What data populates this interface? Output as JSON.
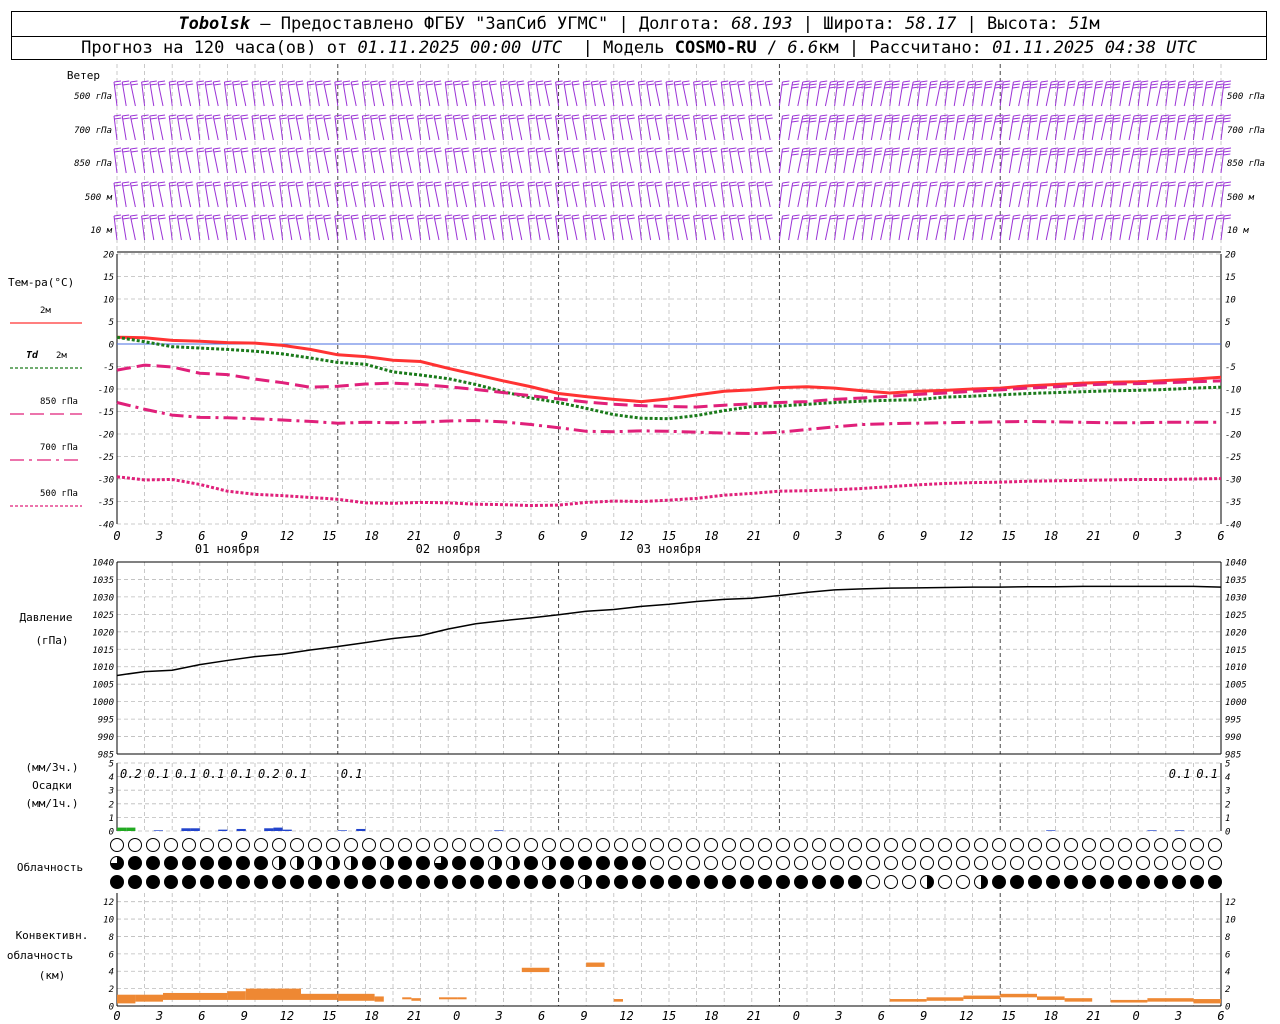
{
  "header": {
    "station": "Tobolsk",
    "sep": " — ",
    "provider": "Предоставлено ФГБУ \"ЗапСиб УГМС\"",
    "lon_label": "Долгота:",
    "lon": "68.193",
    "lat_label": "Широта:",
    "lat": "58.17",
    "alt_label": "Высота:",
    "alt": "51",
    "alt_unit": "м",
    "forecast_prefix": "Прогноз на 120 часа(ов) от",
    "forecast_from": "01.11.2025 00:00 UTC",
    "model_label": "Модель",
    "model": "COSMO-RU",
    "model_res": "6.6",
    "model_res_unit": "км",
    "calc_label": "Рассчитано:",
    "calc_time": "01.11.2025 04:38 UTC"
  },
  "chart_data": [
    {
      "type": "wind-barbs",
      "panel_label": "Ветер",
      "levels": [
        "500 гПа",
        "700 гПа",
        "850 гПа",
        "500 м",
        "10 м"
      ],
      "x_hours": [
        0,
        120
      ],
      "colors": {
        "barb": "#9b34d6"
      },
      "time_step_hours": 1
    },
    {
      "type": "line",
      "panel_label": "Тем-ра(°C)",
      "ylim": [
        -40,
        20
      ],
      "yticks": [
        20,
        15,
        10,
        5,
        0,
        -5,
        -10,
        -15,
        -20,
        -25,
        -30,
        -35,
        -40
      ],
      "grid": true,
      "zero_line_color": "#4a6fe0",
      "legend": [
        {
          "label": "2м",
          "prefix": "",
          "color": "#ff3333",
          "style": "solid"
        },
        {
          "label": "2м",
          "prefix": "Td",
          "color": "#1a7a1a",
          "style": "dotted"
        },
        {
          "label": "850 гПа",
          "prefix": "",
          "color": "#e0207a",
          "style": "dashed"
        },
        {
          "label": "700 гПа",
          "prefix": "",
          "color": "#e0207a",
          "style": "dashdot"
        },
        {
          "label": "500 гПа",
          "prefix": "",
          "color": "#e0207a",
          "style": "dotted"
        }
      ],
      "x_hours": [
        0,
        3,
        6,
        9,
        12,
        15,
        18,
        21,
        24,
        27,
        30,
        33,
        36,
        39,
        42,
        45,
        48,
        51,
        54,
        57,
        60,
        63,
        66,
        69,
        72,
        75,
        78,
        81,
        84,
        87,
        90,
        93,
        96,
        99,
        102,
        105,
        108,
        111,
        114,
        117,
        120
      ],
      "series": [
        {
          "name": "2м",
          "values": [
            1.5,
            1.4,
            0.8,
            0.6,
            0.3,
            0.2,
            -0.3,
            -1.2,
            -2.4,
            -2.8,
            -3.6,
            -3.9,
            -5.4,
            -6.8,
            -8.2,
            -9.5,
            -11.0,
            -11.7,
            -12.3,
            -12.8,
            -12.2,
            -11.3,
            -10.5,
            -10.2,
            -9.7,
            -9.5,
            -9.8,
            -10.4,
            -10.9,
            -10.5,
            -10.3,
            -10.0,
            -9.8,
            -9.3,
            -9.0,
            -8.7,
            -8.5,
            -8.4,
            -8.1,
            -7.8,
            -7.4
          ]
        },
        {
          "name": "Td 2м",
          "values": [
            1.5,
            0.5,
            -0.6,
            -0.9,
            -1.2,
            -1.6,
            -2.2,
            -3.1,
            -4.1,
            -4.5,
            -6.2,
            -6.9,
            -7.7,
            -9.0,
            -10.6,
            -12.0,
            -13.0,
            -14.3,
            -15.7,
            -16.5,
            -16.6,
            -15.9,
            -14.8,
            -13.9,
            -13.8,
            -13.4,
            -13.0,
            -12.7,
            -12.5,
            -12.4,
            -11.8,
            -11.6,
            -11.3,
            -11.0,
            -10.8,
            -10.6,
            -10.4,
            -10.3,
            -10.1,
            -9.8,
            -9.6
          ]
        },
        {
          "name": "850 гПа",
          "values": [
            -5.8,
            -4.7,
            -5.1,
            -6.5,
            -6.8,
            -7.8,
            -8.6,
            -9.6,
            -9.4,
            -8.9,
            -8.7,
            -9.0,
            -9.5,
            -10.1,
            -10.8,
            -11.5,
            -12.2,
            -12.9,
            -13.4,
            -13.7,
            -13.9,
            -14.0,
            -13.6,
            -13.3,
            -13.0,
            -12.8,
            -12.3,
            -12.0,
            -11.6,
            -11.2,
            -10.9,
            -10.5,
            -10.2,
            -9.8,
            -9.5,
            -9.1,
            -8.9,
            -8.8,
            -8.6,
            -8.4,
            -8.2
          ]
        },
        {
          "name": "700 гПа",
          "values": [
            -13.0,
            -14.5,
            -15.8,
            -16.3,
            -16.4,
            -16.6,
            -16.9,
            -17.2,
            -17.6,
            -17.4,
            -17.5,
            -17.4,
            -17.1,
            -17.0,
            -17.3,
            -17.9,
            -18.6,
            -19.4,
            -19.5,
            -19.3,
            -19.4,
            -19.6,
            -19.8,
            -19.9,
            -19.6,
            -19.0,
            -18.4,
            -17.9,
            -17.7,
            -17.6,
            -17.5,
            -17.4,
            -17.3,
            -17.2,
            -17.3,
            -17.4,
            -17.5,
            -17.5,
            -17.4,
            -17.4,
            -17.4
          ]
        },
        {
          "name": "500 гПа",
          "values": [
            -29.5,
            -30.2,
            -30.1,
            -31.2,
            -32.7,
            -33.4,
            -33.7,
            -34.1,
            -34.5,
            -35.3,
            -35.4,
            -35.2,
            -35.3,
            -35.6,
            -35.7,
            -35.9,
            -35.8,
            -35.2,
            -34.9,
            -35.0,
            -34.7,
            -34.3,
            -33.6,
            -33.2,
            -32.7,
            -32.6,
            -32.4,
            -32.1,
            -31.7,
            -31.3,
            -31.0,
            -30.8,
            -30.7,
            -30.5,
            -30.4,
            -30.3,
            -30.2,
            -30.1,
            -30.1,
            -30.0,
            -29.9
          ]
        }
      ]
    },
    {
      "type": "line",
      "panel_label": "Давление",
      "panel_unit": "(гПа)",
      "ylim": [
        985,
        1040
      ],
      "yticks": [
        1040,
        1035,
        1030,
        1025,
        1020,
        1015,
        1010,
        1005,
        1000,
        995,
        990,
        985
      ],
      "grid": true,
      "x_hours": [
        0,
        3,
        6,
        9,
        12,
        15,
        18,
        21,
        24,
        27,
        30,
        33,
        36,
        39,
        42,
        45,
        48,
        51,
        54,
        57,
        60,
        63,
        66,
        69,
        72,
        75,
        78,
        81,
        84,
        87,
        90,
        93,
        96,
        99,
        102,
        105,
        108,
        111,
        114,
        117,
        120
      ],
      "series": [
        {
          "name": "",
          "values": [
            1007.5,
            1008.6,
            1009.0,
            1010.6,
            1011.8,
            1012.9,
            1013.6,
            1014.8,
            1015.8,
            1016.9,
            1018.1,
            1018.9,
            1020.8,
            1022.3,
            1023.2,
            1024.0,
            1024.9,
            1025.9,
            1026.4,
            1027.3,
            1027.9,
            1028.7,
            1029.3,
            1029.6,
            1030.4,
            1031.3,
            1032.0,
            1032.3,
            1032.5,
            1032.6,
            1032.7,
            1032.8,
            1032.8,
            1032.9,
            1032.9,
            1033.0,
            1033.0,
            1033.0,
            1033.0,
            1033.0,
            1032.8
          ]
        }
      ],
      "colors": {
        "line": "#000000"
      }
    },
    {
      "type": "bar",
      "panel_label": "Осадки",
      "unit_top": "(мм/3ч.)",
      "unit_bottom": "(мм/1ч.)",
      "ylim": [
        0,
        5
      ],
      "yticks": [
        5,
        4,
        3,
        2,
        1,
        0
      ],
      "grid": true,
      "labels_3h": [
        {
          "hour": 1.5,
          "text": "0.2"
        },
        {
          "hour": 4.5,
          "text": "0.1"
        },
        {
          "hour": 7.5,
          "text": "0.1"
        },
        {
          "hour": 10.5,
          "text": "0.1"
        },
        {
          "hour": 13.5,
          "text": "0.1"
        },
        {
          "hour": 16.5,
          "text": "0.2"
        },
        {
          "hour": 19.5,
          "text": "0.1"
        },
        {
          "hour": 25.5,
          "text": "0.1"
        },
        {
          "hour": 115.5,
          "text": "0.1"
        },
        {
          "hour": 118.5,
          "text": "0.1"
        }
      ],
      "bars_1h": [
        {
          "hour": 1,
          "value": 0.25,
          "color": "#22aa22"
        },
        {
          "hour": 2,
          "value": 0.25,
          "color": "#22aa22"
        },
        {
          "hour": 5,
          "value": 0.05,
          "color": "#2244cc"
        },
        {
          "hour": 8,
          "value": 0.2,
          "color": "#2244cc"
        },
        {
          "hour": 9,
          "value": 0.2,
          "color": "#2244cc"
        },
        {
          "hour": 12,
          "value": 0.1,
          "color": "#2244cc"
        },
        {
          "hour": 14,
          "value": 0.15,
          "color": "#2244cc"
        },
        {
          "hour": 17,
          "value": 0.2,
          "color": "#2244cc"
        },
        {
          "hour": 18,
          "value": 0.25,
          "color": "#2244cc"
        },
        {
          "hour": 19,
          "value": 0.1,
          "color": "#2244cc"
        },
        {
          "hour": 25,
          "value": 0.05,
          "color": "#2244cc"
        },
        {
          "hour": 27,
          "value": 0.15,
          "color": "#2244cc"
        },
        {
          "hour": 42,
          "value": 0.05,
          "color": "#2244cc"
        },
        {
          "hour": 102,
          "value": 0.05,
          "color": "#2244cc"
        },
        {
          "hour": 113,
          "value": 0.05,
          "color": "#2244cc"
        },
        {
          "hour": 116,
          "value": 0.05,
          "color": "#2244cc"
        }
      ]
    },
    {
      "type": "cloud-symbols",
      "panel_label": "Облачность",
      "rows": [
        "верхний ярус",
        "средний ярус",
        "нижний ярус"
      ],
      "note": "octa cover 0–8 per 1h step",
      "upper": [
        0,
        0,
        0,
        0,
        0,
        0,
        0,
        0,
        0,
        0,
        0,
        0,
        0,
        0,
        0,
        0,
        0,
        0,
        0,
        0,
        0,
        0,
        0,
        0,
        0,
        0,
        0,
        0,
        0,
        0,
        0,
        0,
        0,
        0,
        0,
        0,
        0,
        0,
        0,
        0,
        0,
        0,
        0,
        0,
        0,
        0,
        0,
        0,
        0,
        0,
        0,
        0,
        0,
        0,
        0,
        0,
        0,
        0,
        0,
        0,
        0,
        0,
        0,
        0,
        0,
        0,
        0,
        0,
        0,
        0,
        0,
        0,
        0,
        0,
        0,
        0,
        0,
        0,
        0,
        0,
        0,
        0,
        0,
        0,
        0,
        0,
        0,
        0,
        0,
        0,
        0,
        0,
        0,
        0,
        0,
        0,
        0,
        0,
        0,
        0,
        0,
        0,
        0,
        0,
        0,
        0,
        0,
        0,
        0,
        0,
        0,
        0,
        0,
        0,
        0,
        0,
        0,
        0,
        0,
        0,
        0
      ],
      "middle": [
        6,
        8,
        8,
        8,
        8,
        8,
        8,
        8,
        8,
        8,
        8,
        8,
        8,
        8,
        8,
        4,
        8,
        8,
        4,
        4,
        4,
        4,
        4,
        4,
        4,
        4,
        4,
        6,
        8,
        8,
        4,
        8,
        8,
        8,
        8,
        6,
        8,
        8,
        8,
        8,
        4,
        4,
        4,
        4,
        6,
        8,
        8,
        4,
        8,
        8,
        4,
        8,
        8,
        8,
        4,
        8,
        8,
        8,
        6,
        0,
        0,
        0,
        0,
        0,
        0,
        0,
        0,
        0,
        0,
        0,
        0,
        0,
        0,
        0,
        0,
        0,
        0,
        0,
        0,
        0,
        0,
        0,
        0,
        0,
        0,
        0,
        0,
        0,
        0,
        0,
        0,
        0,
        0,
        0,
        0,
        0,
        0,
        0,
        0,
        0,
        0,
        0,
        0,
        0,
        0,
        0,
        0,
        0,
        0,
        0,
        0,
        0,
        0,
        0,
        0,
        0,
        0,
        0,
        0,
        0,
        0
      ],
      "lower": [
        8,
        8,
        8,
        8,
        8,
        8,
        8,
        8,
        8,
        8,
        8,
        8,
        8,
        8,
        8,
        8,
        8,
        8,
        8,
        8,
        8,
        8,
        8,
        8,
        8,
        8,
        8,
        8,
        8,
        8,
        8,
        8,
        8,
        8,
        8,
        8,
        8,
        8,
        8,
        8,
        8,
        8,
        8,
        8,
        8,
        8,
        8,
        8,
        8,
        8,
        4,
        4,
        8,
        8,
        8,
        8,
        8,
        8,
        8,
        8,
        8,
        8,
        8,
        8,
        8,
        8,
        8,
        8,
        8,
        8,
        8,
        8,
        8,
        8,
        8,
        8,
        8,
        8,
        8,
        8,
        0,
        8,
        8,
        0,
        0,
        0,
        0,
        0,
        0,
        4,
        0,
        0,
        0,
        0,
        4,
        0,
        8,
        8,
        8,
        8,
        8,
        8,
        8,
        8,
        8,
        8,
        8,
        8,
        8,
        8,
        8,
        8,
        8,
        8,
        8,
        8,
        8,
        8,
        8,
        8,
        8
      ]
    },
    {
      "type": "bar",
      "panel_label": "Конвективн. облачность",
      "panel_unit": "(км)",
      "ylim": [
        0,
        13
      ],
      "yticks": [
        12,
        10,
        8,
        6,
        4,
        2,
        0
      ],
      "grid": true,
      "colors": {
        "bar": "#ee8833"
      },
      "layers": [
        {
          "from": 0,
          "to": 2,
          "base": 0.3,
          "top": 1.3
        },
        {
          "from": 2,
          "to": 5,
          "base": 0.5,
          "top": 1.3
        },
        {
          "from": 5,
          "to": 12,
          "base": 0.7,
          "top": 1.5
        },
        {
          "from": 12,
          "to": 14,
          "base": 0.7,
          "top": 1.7
        },
        {
          "from": 14,
          "to": 20,
          "base": 0.7,
          "top": 2.0
        },
        {
          "from": 20,
          "to": 24,
          "base": 0.7,
          "top": 1.4
        },
        {
          "from": 24,
          "to": 28,
          "base": 0.6,
          "top": 1.4
        },
        {
          "from": 28,
          "to": 29,
          "base": 0.5,
          "top": 1.1
        },
        {
          "from": 31,
          "to": 32,
          "base": 0.8,
          "top": 1.0
        },
        {
          "from": 32,
          "to": 33,
          "base": 0.6,
          "top": 0.9
        },
        {
          "from": 35,
          "to": 37,
          "base": 0.9,
          "top": 1.0
        },
        {
          "from": 37,
          "to": 38,
          "base": 0.9,
          "top": 1.0
        },
        {
          "from": 44,
          "to": 47,
          "base": 3.9,
          "top": 4.4
        },
        {
          "from": 51,
          "to": 53,
          "base": 4.5,
          "top": 5.0
        },
        {
          "from": 54,
          "to": 55,
          "base": 0.5,
          "top": 0.8
        },
        {
          "from": 84,
          "to": 88,
          "base": 0.5,
          "top": 0.8
        },
        {
          "from": 88,
          "to": 92,
          "base": 0.6,
          "top": 1.0
        },
        {
          "from": 92,
          "to": 96,
          "base": 0.8,
          "top": 1.2
        },
        {
          "from": 96,
          "to": 100,
          "base": 1.0,
          "top": 1.4
        },
        {
          "from": 100,
          "to": 103,
          "base": 0.7,
          "top": 1.1
        },
        {
          "from": 103,
          "to": 106,
          "base": 0.5,
          "top": 0.9
        },
        {
          "from": 108,
          "to": 112,
          "base": 0.4,
          "top": 0.7
        },
        {
          "from": 112,
          "to": 117,
          "base": 0.5,
          "top": 0.9
        },
        {
          "from": 117,
          "to": 120,
          "base": 0.3,
          "top": 0.8
        }
      ]
    }
  ],
  "time_axis": {
    "tick_labels": [
      "0",
      "3",
      "6",
      "9",
      "12",
      "15",
      "18",
      "21",
      "0",
      "3",
      "6",
      "9",
      "12",
      "15",
      "18",
      "21",
      "0",
      "3",
      "6",
      "9",
      "12",
      "15",
      "18",
      "21",
      "0",
      "3",
      "6"
    ],
    "day_labels": [
      {
        "hour_center": 12,
        "text": "01 ноября"
      },
      {
        "hour_center": 36,
        "text": "02 ноября"
      },
      {
        "hour_center": 60,
        "text": "03 ноября"
      }
    ]
  }
}
